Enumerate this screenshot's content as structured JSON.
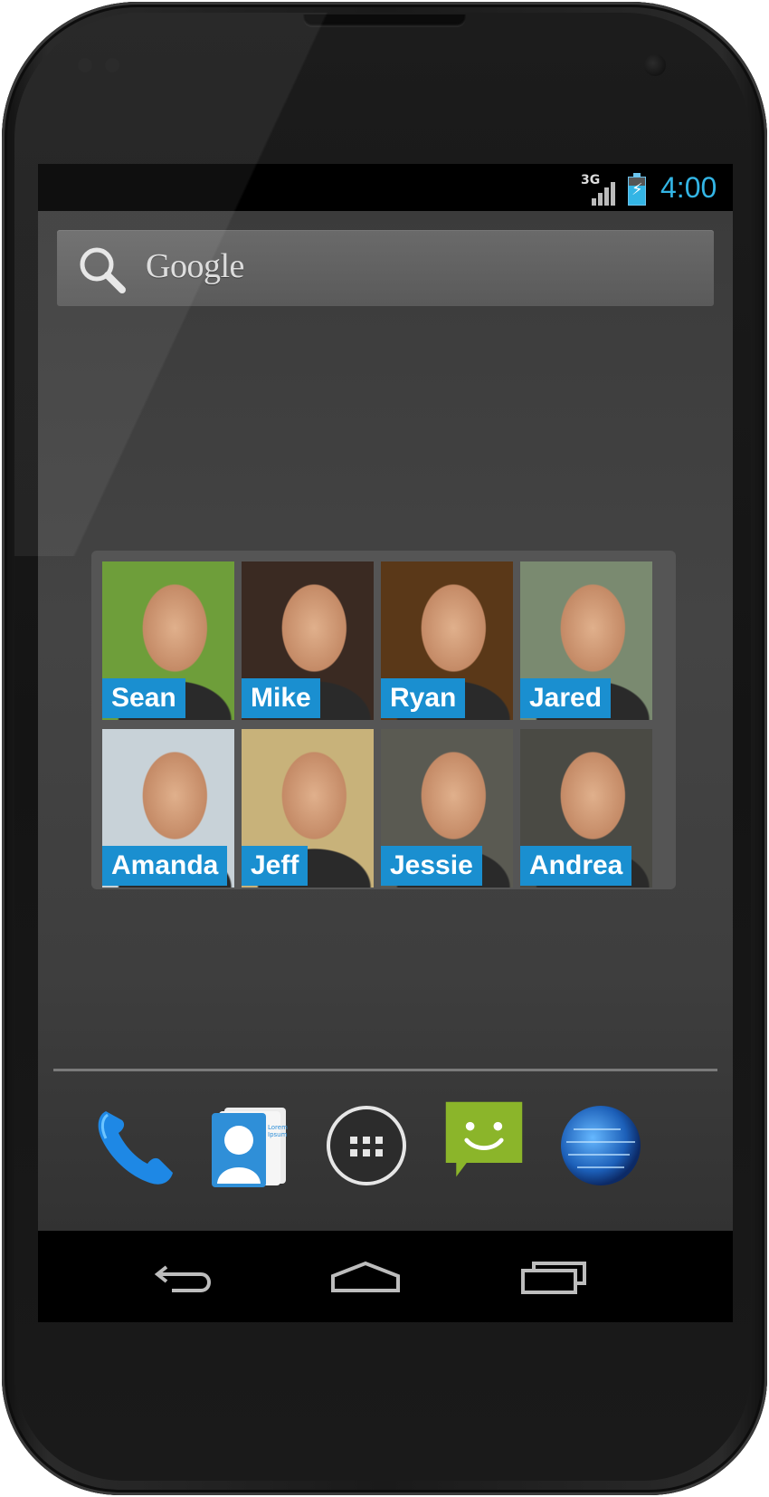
{
  "status_bar": {
    "network": "3G",
    "time": "4:00",
    "accent_color": "#33b5e5"
  },
  "search": {
    "label": "Google",
    "icon": "search-icon"
  },
  "contacts": [
    {
      "name": "Sean",
      "bg": "#6e9e3a"
    },
    {
      "name": "Mike",
      "bg": "#3a2a22"
    },
    {
      "name": "Ryan",
      "bg": "#5a3818"
    },
    {
      "name": "Jared",
      "bg": "#7a8a70"
    },
    {
      "name": "Amanda",
      "bg": "#c8d2d8"
    },
    {
      "name": "Jeff",
      "bg": "#c8b27a"
    },
    {
      "name": "Jessie",
      "bg": "#5a5a52"
    },
    {
      "name": "Andrea",
      "bg": "#4a4a44"
    }
  ],
  "contact_label_color": "#1a8fd0",
  "dock": [
    {
      "icon": "phone-icon"
    },
    {
      "icon": "contacts-icon",
      "card_text": "Lorem Ipsum"
    },
    {
      "icon": "app-drawer-icon"
    },
    {
      "icon": "messaging-icon"
    },
    {
      "icon": "browser-globe-icon"
    }
  ],
  "navigation": [
    {
      "icon": "back-icon"
    },
    {
      "icon": "home-icon"
    },
    {
      "icon": "recent-apps-icon"
    }
  ]
}
